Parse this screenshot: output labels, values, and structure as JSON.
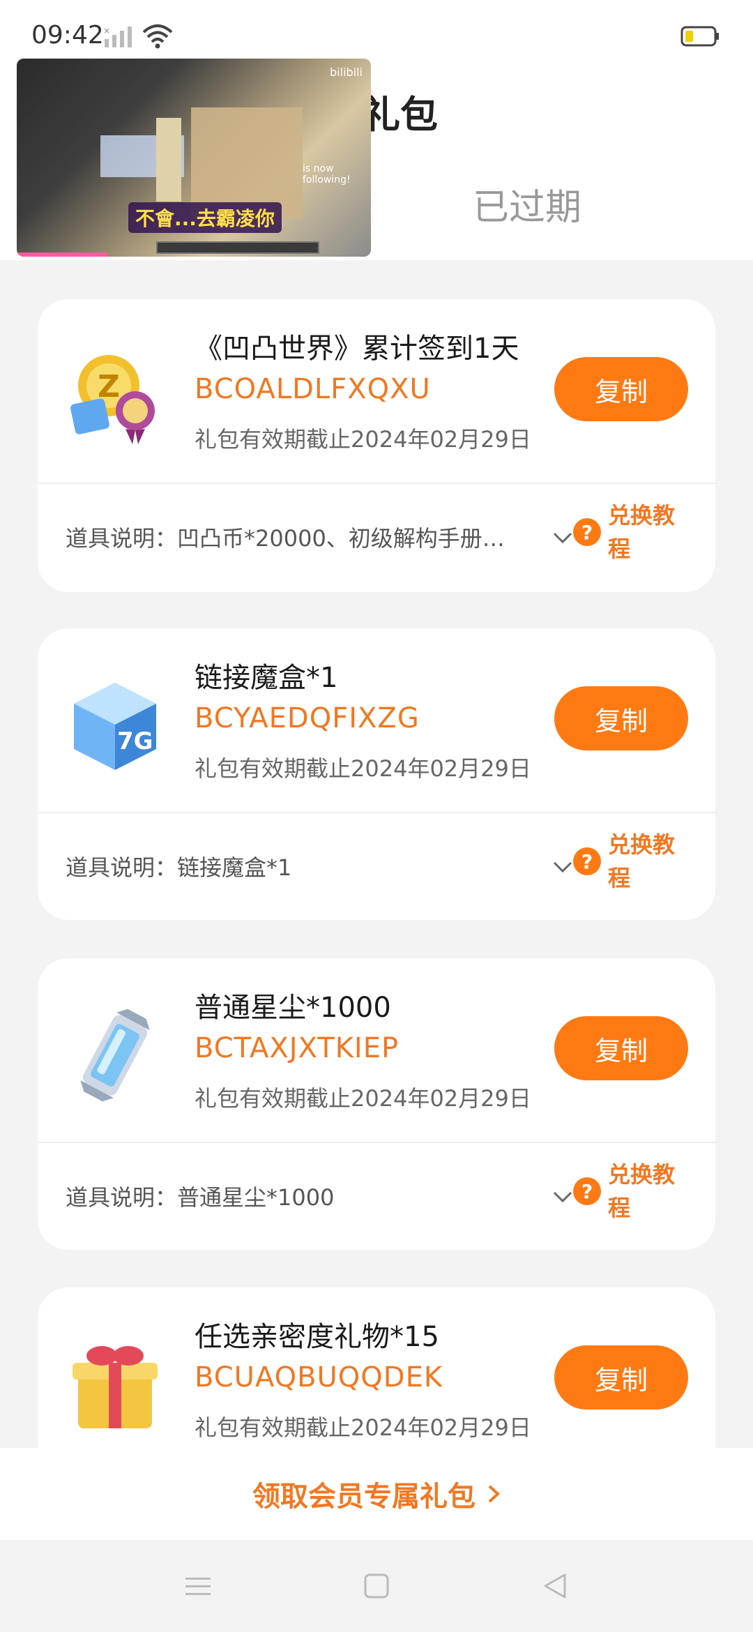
{
  "status": {
    "time": "09:42"
  },
  "page": {
    "title_partial": "礼包",
    "tab_expired": "已过期"
  },
  "video": {
    "subtitle": "不會...去霸凌你",
    "logo": "bilibili",
    "chat_line": "is now following!"
  },
  "cards": [
    {
      "name": "《凹凸世界》累计签到1天",
      "code": "BCOALDLFXQXU",
      "expiry": "礼包有效期截止2024年02月29日",
      "copy_label": "复制",
      "desc": "道具说明：凹凸币*20000、初级解构手册…",
      "help_label": "兑换教程",
      "icon": "coin-badge-icon"
    },
    {
      "name": "链接魔盒*1",
      "code": "BCYAEDQFIXZG",
      "expiry": "礼包有效期截止2024年02月29日",
      "copy_label": "复制",
      "desc": "道具说明：链接魔盒*1",
      "help_label": "兑换教程",
      "icon": "magic-cube-icon"
    },
    {
      "name": "普通星尘*1000",
      "code": "BCTAXJXTKIEP",
      "expiry": "礼包有效期截止2024年02月29日",
      "copy_label": "复制",
      "desc": "道具说明：普通星尘*1000",
      "help_label": "兑换教程",
      "icon": "stardust-crystal-icon"
    },
    {
      "name": "任选亲密度礼物*15",
      "code": "BCUAQBUQQDEK",
      "expiry": "礼包有效期截止2024年02月29日",
      "copy_label": "复制",
      "icon": "gift-box-icon"
    }
  ],
  "bottom": {
    "label": "领取会员专属礼包"
  },
  "colors": {
    "accent": "#ff7a13",
    "code_text": "#f07822"
  }
}
